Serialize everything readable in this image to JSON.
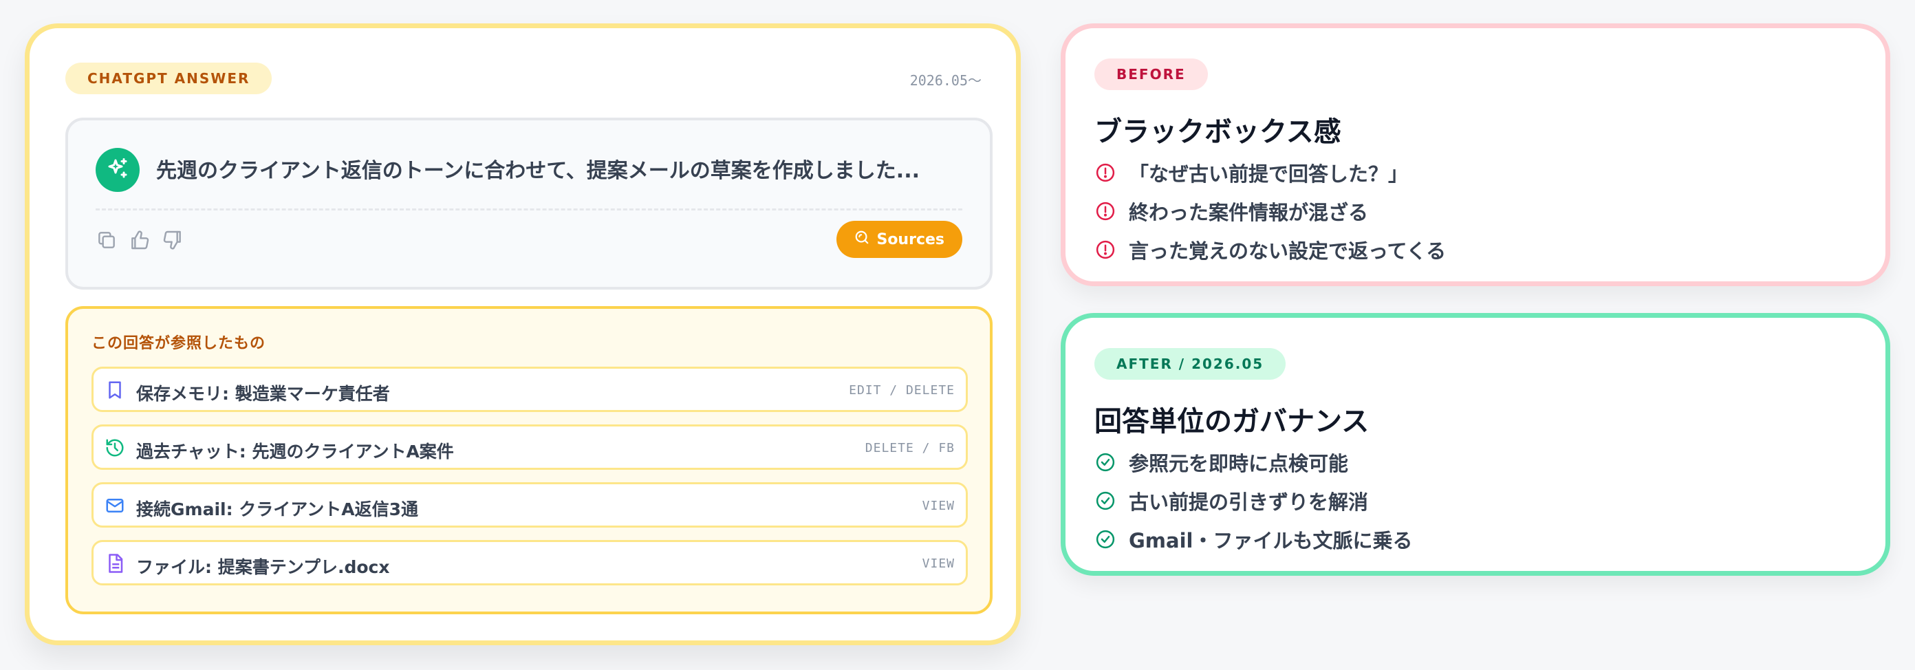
{
  "answer_card": {
    "badge": "CHATGPT ANSWER",
    "date": "2026.05〜",
    "message": "先週のクライアント返信のトーンに合わせて、提案メールの草案を作成しました...",
    "sources_label": "Sources",
    "action_icons": [
      "copy-icon",
      "thumbs-up-icon",
      "thumbs-down-icon"
    ],
    "refs_title": "この回答が参照したもの",
    "refs": [
      {
        "icon": "bookmark-icon",
        "label": "保存メモリ: 製造業マーケ責任者",
        "actions": "EDIT / DELETE",
        "color": "#6366f1"
      },
      {
        "icon": "history-icon",
        "label": "過去チャット: 先週のクライアントA案件",
        "actions": "DELETE / FB",
        "color": "#10b981"
      },
      {
        "icon": "mail-icon",
        "label": "接続Gmail: クライアントA返信3通",
        "actions": "VIEW",
        "color": "#3b82f6"
      },
      {
        "icon": "file-icon",
        "label": "ファイル: 提案書テンプレ.docx",
        "actions": "VIEW",
        "color": "#8b5cf6"
      }
    ]
  },
  "before": {
    "badge": "BEFORE",
    "title": "ブラックボックス感",
    "items": [
      "「なぜ古い前提で回答した？」",
      "終わった案件情報が混ざる",
      "言った覚えのない設定で返ってくる"
    ],
    "icon": "alert-circle-icon",
    "color": "#e11d48"
  },
  "after": {
    "badge": "AFTER / 2026.05",
    "title": "回答単位のガバナンス",
    "items": [
      "参照元を即時に点検可能",
      "古い前提の引きずりを解消",
      "Gmail・ファイルも文脈に乗る"
    ],
    "icon": "check-circle-icon",
    "color": "#059669"
  },
  "colors": {
    "accent_yellow": "#fde68a",
    "sources_orange": "#f59e0b",
    "avatar_green": "#10b981"
  }
}
